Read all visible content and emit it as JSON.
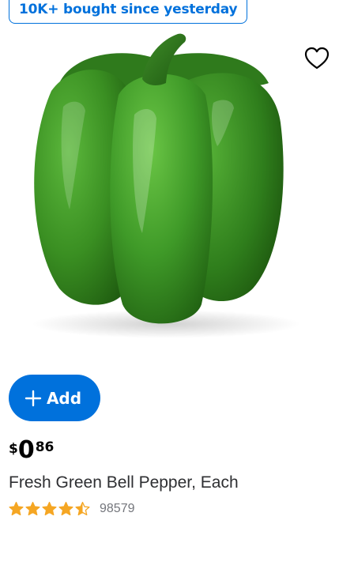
{
  "badge": {
    "text": "10K+ bought since yesterday",
    "color": "#0071dc"
  },
  "favorite": {
    "icon": "heart-outline-icon"
  },
  "product_image": {
    "subject": "green bell pepper",
    "color": "#3f9a2a"
  },
  "add_button": {
    "label": "Add",
    "icon": "plus-icon",
    "color": "#0071dc"
  },
  "price": {
    "currency": "$",
    "dollars": "0",
    "cents": "86"
  },
  "product": {
    "title": "Fresh Green Bell Pepper, Each"
  },
  "rating": {
    "value": 4.5,
    "max": 5,
    "count": "98579",
    "star_color": "#f5a623"
  }
}
